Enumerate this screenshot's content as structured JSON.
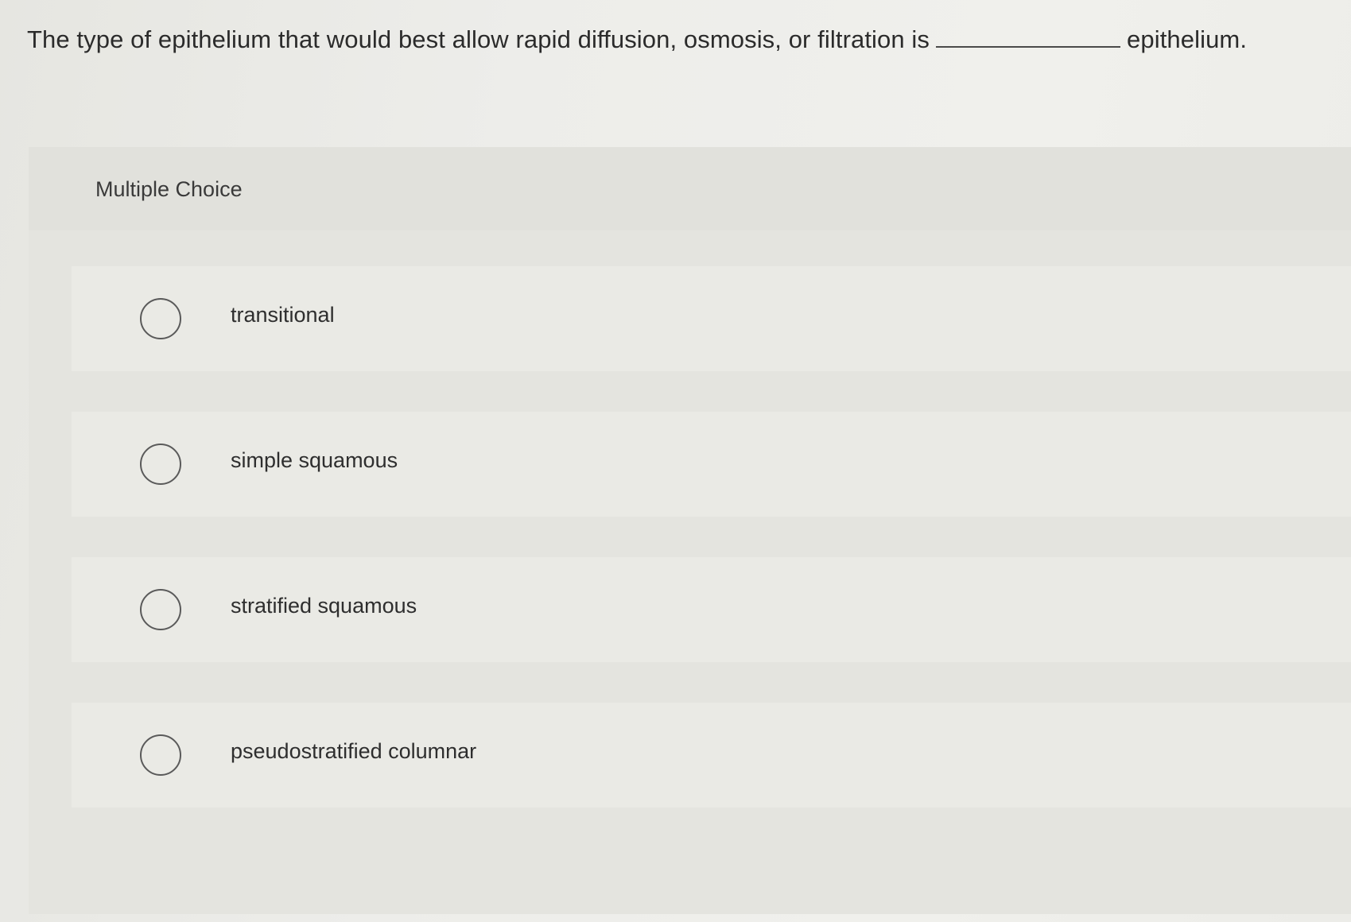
{
  "question": {
    "text_before": "The type of epithelium that would best allow rapid diffusion, osmosis, or filtration is",
    "text_after": "epithelium."
  },
  "multiple_choice": {
    "label": "Multiple Choice",
    "options": [
      {
        "label": "transitional",
        "selected": false
      },
      {
        "label": "simple squamous",
        "selected": false
      },
      {
        "label": "stratified squamous",
        "selected": false
      },
      {
        "label": "pseudostratified columnar",
        "selected": false
      }
    ]
  }
}
